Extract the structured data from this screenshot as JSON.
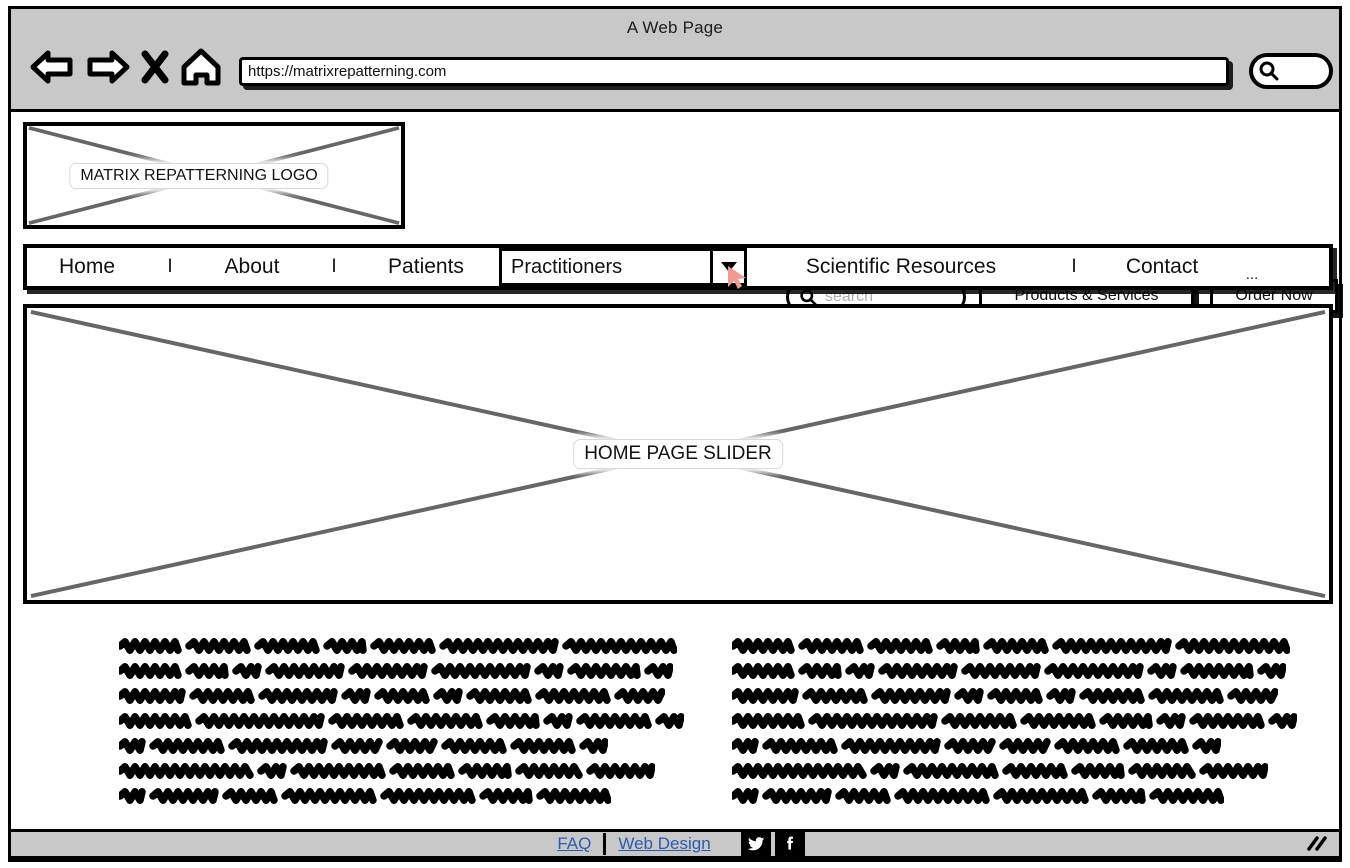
{
  "browser": {
    "window_title": "A Web Page",
    "url": "https://matrixrepatterning.com",
    "toolbar_icons": [
      {
        "name": "back-arrow-icon",
        "glyph": "back"
      },
      {
        "name": "forward-arrow-icon",
        "glyph": "forward"
      },
      {
        "name": "stop-close-icon",
        "glyph": "x"
      },
      {
        "name": "home-icon",
        "glyph": "home"
      }
    ],
    "chrome_search_icon": "search-icon",
    "chrome_bar_color": "#c8c8c8"
  },
  "header": {
    "logo_placeholder_label": "MATRIX REPATTERNING LOGO",
    "search": {
      "icon": "search-icon",
      "placeholder": "search",
      "value": ""
    },
    "buttons": [
      {
        "name": "products-and-services-button",
        "label": "Products & Services"
      },
      {
        "name": "order-now-button",
        "label": "Order Now"
      }
    ]
  },
  "nav": {
    "items": [
      {
        "label": "Home",
        "type": "link"
      },
      {
        "label": "I",
        "type": "separator"
      },
      {
        "label": "About",
        "type": "link"
      },
      {
        "label": "I",
        "type": "separator"
      },
      {
        "label": "Patients",
        "type": "link"
      },
      {
        "label": "Practitioners",
        "type": "dropdown"
      },
      {
        "label": "Scientific Resources",
        "type": "link"
      },
      {
        "label": "I",
        "type": "separator"
      },
      {
        "label": "Contact",
        "type": "link"
      },
      {
        "label": "...",
        "type": "overflow"
      }
    ],
    "dropdown_selected": "Practitioners",
    "dropdown_arrow_icon": "chevron-down-icon",
    "cursor_color": "#ef9b91"
  },
  "main": {
    "slider_placeholder_label": "HOME PAGE SLIDER",
    "columns": [
      {
        "name": "left-text-column",
        "line_widths": [
          478,
          468,
          444,
          494,
          388,
          484,
          470
        ]
      },
      {
        "name": "right-text-column",
        "line_widths": [
          478,
          468,
          444,
          494,
          388,
          484,
          470
        ]
      }
    ]
  },
  "footer": {
    "links": [
      {
        "name": "faq-link",
        "label": "FAQ"
      },
      {
        "name": "web-design-link",
        "label": "Web Design"
      }
    ],
    "link_color": "#2a5db0",
    "social": [
      {
        "name": "twitter-icon",
        "label": "twitter"
      },
      {
        "name": "facebook-icon",
        "label": "facebook"
      }
    ],
    "background_color": "#c8c8c8"
  },
  "status_bar": {
    "resize_grip_icon": "resize-grip-icon"
  }
}
